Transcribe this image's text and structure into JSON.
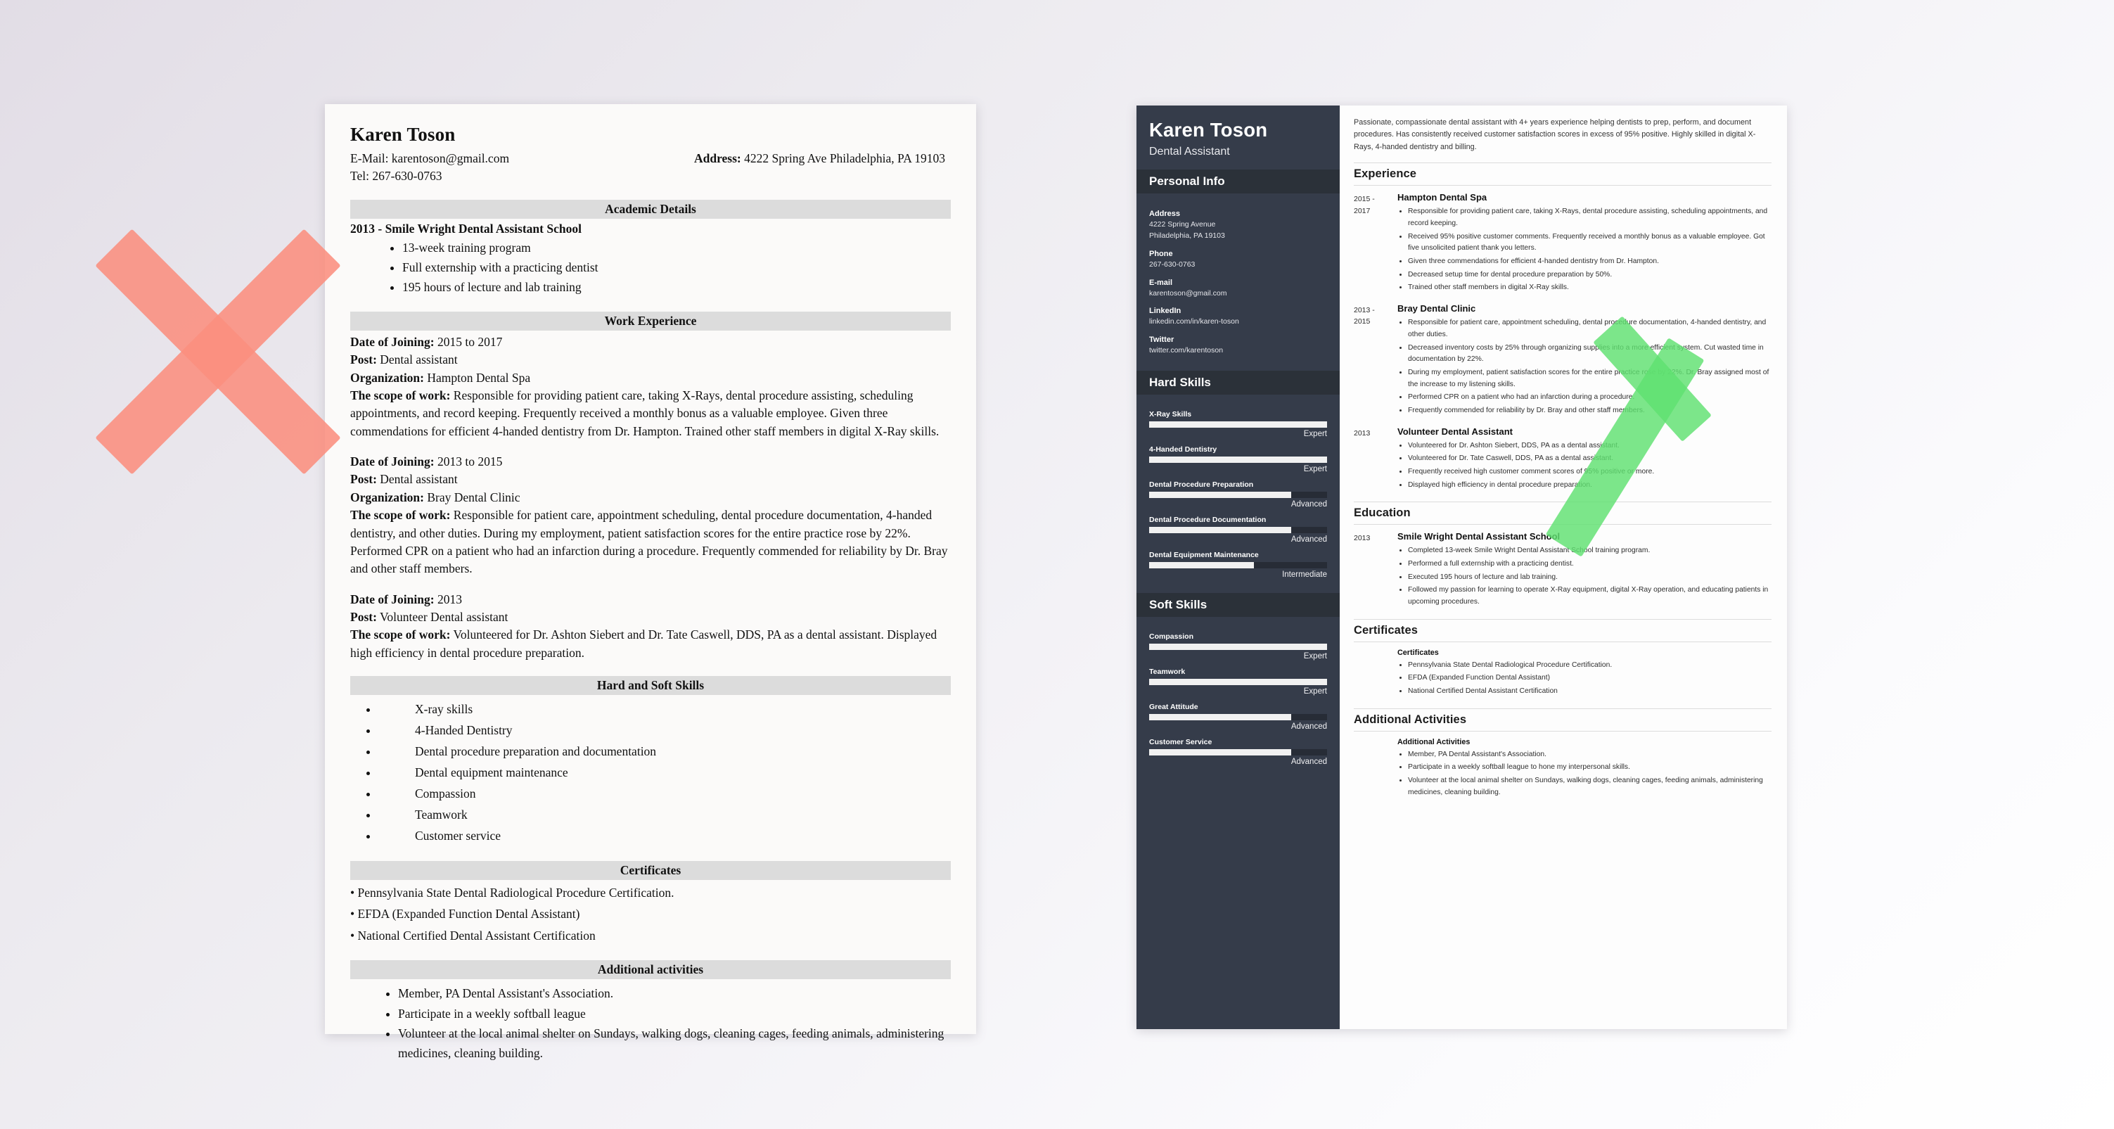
{
  "colors": {
    "background_start": "#e2dde6",
    "background_end": "#ffffff",
    "x_mark": "#fa8e7e",
    "check_mark": "#5fe070",
    "sidebar_dark": "#353c4a",
    "sidebar_header_dark": "#2b3139",
    "section_bar_grey": "#dcdcdc"
  },
  "left_resume": {
    "name": "Karen Toson",
    "email_line": "E-Mail: karentoson@gmail.com",
    "email_label": "E-Mail:",
    "email_value": "karentoson@gmail.com",
    "tel_line": "Tel: 267-630-0763",
    "tel_label": "Tel:",
    "tel_value": "267-630-0763",
    "address_label": "Address:",
    "address_value": "4222 Spring Ave Philadelphia, PA 19103",
    "sections": {
      "academic": {
        "title": "Academic Details",
        "entry_heading": "2013 - Smile Wright Dental Assistant School",
        "bullets": [
          "13-week training program",
          "Full externship with a practicing dentist",
          "195 hours of lecture and lab training"
        ]
      },
      "work": {
        "title": "Work Experience",
        "jobs": [
          {
            "date_label": "Date of Joining:",
            "date_value": "2015 to 2017",
            "post_label": "Post:",
            "post_value": "Dental assistant",
            "org_label": "Organization:",
            "org_value": "Hampton Dental Spa",
            "scope_label": "The scope of work:",
            "scope_value": "Responsible for providing patient care, taking X-Rays, dental procedure assisting, scheduling appointments, and record keeping. Frequently received a monthly bonus as a valuable employee. Given three commendations for efficient 4-handed dentistry from Dr. Hampton. Trained other staff members in digital X-Ray skills."
          },
          {
            "date_label": "Date of Joining:",
            "date_value": "2013 to 2015",
            "post_label": "Post:",
            "post_value": "Dental assistant",
            "org_label": "Organization:",
            "org_value": "Bray Dental Clinic",
            "scope_label": "The scope of work:",
            "scope_value": "Responsible for patient care, appointment scheduling, dental procedure documentation, 4-handed dentistry, and other duties. During my employment, patient satisfaction scores for the entire practice rose by 22%. Performed CPR on a patient who had an infarction during a procedure. Frequently commended for reliability by Dr. Bray and other staff members."
          },
          {
            "date_label": "Date of Joining:",
            "date_value": "2013",
            "post_label": "Post:",
            "post_value": "Volunteer Dental assistant",
            "org_label": "",
            "org_value": "",
            "scope_label": "The scope of work:",
            "scope_value": "Volunteered for Dr. Ashton Siebert and Dr. Tate Caswell, DDS, PA as a dental assistant. Displayed high efficiency in dental procedure preparation."
          }
        ]
      },
      "skills": {
        "title": "Hard and Soft Skills",
        "items": [
          "X-ray skills",
          "4-Handed Dentistry",
          "Dental procedure preparation and documentation",
          "Dental equipment maintenance",
          "Compassion",
          "Teamwork",
          "Customer service"
        ]
      },
      "certificates": {
        "title": "Certificates",
        "items": [
          "• Pennsylvania State Dental Radiological Procedure Certification.",
          "• EFDA (Expanded Function Dental Assistant)",
          "• National Certified Dental Assistant Certification"
        ]
      },
      "activities": {
        "title": "Additional activities",
        "items": [
          "Member, PA Dental Assistant's Association.",
          "Participate in a weekly softball league",
          "Volunteer at the local animal shelter on Sundays, walking dogs, cleaning cages, feeding animals, administering medicines, cleaning building."
        ]
      }
    }
  },
  "right_resume": {
    "sidebar": {
      "name": "Karen Toson",
      "job_title": "Dental Assistant",
      "personal_info_heading": "Personal Info",
      "personal_info": [
        {
          "label": "Address",
          "value": "4222 Spring Avenue\nPhiladelphia, PA 19103"
        },
        {
          "label": "Phone",
          "value": "267-630-0763"
        },
        {
          "label": "E-mail",
          "value": "karentoson@gmail.com"
        },
        {
          "label": "LinkedIn",
          "value": "linkedin.com/in/karen-toson"
        },
        {
          "label": "Twitter",
          "value": "twitter.com/karentoson"
        }
      ],
      "hard_skills_heading": "Hard Skills",
      "hard_skills": [
        {
          "name": "X-Ray Skills",
          "level": "Expert",
          "percent": 100
        },
        {
          "name": "4-Handed Dentistry",
          "level": "Expert",
          "percent": 100
        },
        {
          "name": "Dental Procedure Preparation",
          "level": "Advanced",
          "percent": 80
        },
        {
          "name": "Dental Procedure Documentation",
          "level": "Advanced",
          "percent": 80
        },
        {
          "name": "Dental Equipment Maintenance",
          "level": "Intermediate",
          "percent": 59
        }
      ],
      "soft_skills_heading": "Soft Skills",
      "soft_skills": [
        {
          "name": "Compassion",
          "level": "Expert",
          "percent": 100
        },
        {
          "name": "Teamwork",
          "level": "Expert",
          "percent": 100
        },
        {
          "name": "Great Attitude",
          "level": "Advanced",
          "percent": 80
        },
        {
          "name": "Customer Service",
          "level": "Advanced",
          "percent": 80
        }
      ]
    },
    "main": {
      "summary": "Passionate, compassionate dental assistant with 4+ years experience helping dentists to prep, perform, and document procedures. Has consistently received customer satisfaction scores in excess of 95% positive. Highly skilled in digital X-Rays, 4-handed dentistry and billing.",
      "experience_heading": "Experience",
      "experience": [
        {
          "date": "2015 -\n2017",
          "title": "Hampton Dental Spa",
          "bullets": [
            "Responsible for providing patient care, taking X-Rays, dental procedure assisting, scheduling appointments, and record keeping.",
            "Received 95% positive customer comments. Frequently received a monthly bonus as a valuable employee. Got five unsolicited patient thank you letters.",
            "Given three commendations for efficient 4-handed dentistry from Dr. Hampton.",
            "Decreased setup time for dental procedure preparation by 50%.",
            "Trained other staff members in digital X-Ray skills."
          ]
        },
        {
          "date": "2013 -\n2015",
          "title": "Bray Dental Clinic",
          "bullets": [
            "Responsible for patient care, appointment scheduling, dental procedure documentation, 4-handed dentistry, and other duties.",
            "Decreased inventory costs by 25% through organizing supplies into a more efficient system. Cut wasted time in documentation by 22%.",
            "During my employment, patient satisfaction scores for the entire practice rose by 22%. Dr. Bray assigned most of the increase to my listening skills.",
            "Performed CPR on a patient who had an infarction during a procedure.",
            "Frequently commended for reliability by Dr. Bray and other staff members."
          ]
        },
        {
          "date": "2013",
          "title": "Volunteer Dental Assistant",
          "bullets": [
            "Volunteered for Dr. Ashton Siebert, DDS, PA as a dental assistant.",
            "Volunteered for Dr. Tate Caswell, DDS, PA as a dental assistant.",
            "Frequently received high customer comment scores of 95% positive or more.",
            "Displayed high efficiency in dental procedure preparation."
          ]
        }
      ],
      "education_heading": "Education",
      "education": [
        {
          "date": "2013",
          "title": "Smile Wright Dental Assistant School",
          "bullets": [
            "Completed 13-week Smile Wright Dental Assistant School training program.",
            "Performed a full externship with a practicing dentist.",
            "Executed 195 hours of lecture and lab training.",
            "Followed my passion for learning to operate X-Ray equipment, digital X-Ray operation, and educating patients in upcoming procedures."
          ]
        }
      ],
      "certificates_heading": "Certificates",
      "certificates": [
        {
          "date": "",
          "title": "Certificates",
          "bullets": [
            "Pennsylvania State Dental Radiological Procedure Certification.",
            "EFDA (Expanded Function Dental Assistant)",
            "National Certified Dental Assistant Certification"
          ]
        }
      ],
      "activities_heading": "Additional Activities",
      "activities": [
        {
          "date": "",
          "title": "Additional Activities",
          "bullets": [
            "Member, PA Dental Assistant's Association.",
            "Participate in a weekly softball league to hone my interpersonal skills.",
            "Volunteer at the local animal shelter on Sundays, walking dogs, cleaning cages, feeding animals, administering medicines, cleaning building."
          ]
        }
      ]
    }
  }
}
